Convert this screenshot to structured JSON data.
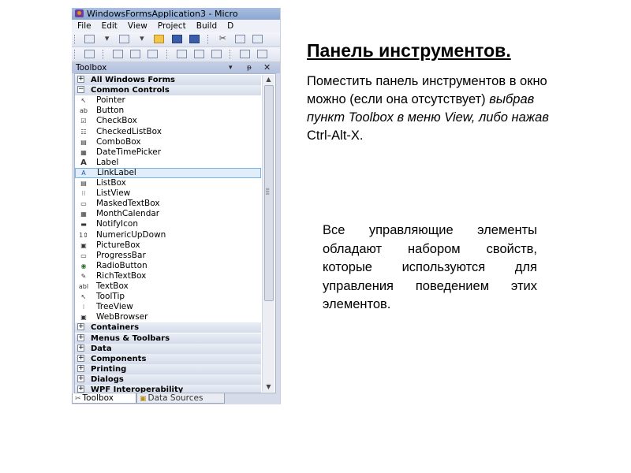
{
  "window": {
    "title": "WindowsFormsApplication3 - Micro",
    "menu": [
      "File",
      "Edit",
      "View",
      "Project",
      "Build",
      "D"
    ]
  },
  "toolbox": {
    "title": "Toolbox",
    "controls": {
      "pin": "▾",
      "autohide": "ᵽ",
      "close": "✕"
    },
    "rows": [
      {
        "kind": "cat",
        "sign": "+",
        "label": "All Windows Forms"
      },
      {
        "kind": "cat",
        "sign": "−",
        "label": "Common Controls"
      },
      {
        "kind": "item",
        "icon": "pointer-icon",
        "glyph": "↖",
        "label": "Pointer"
      },
      {
        "kind": "item",
        "icon": "button-icon",
        "glyph": "ab",
        "label": "Button"
      },
      {
        "kind": "item",
        "icon": "checkbox-icon",
        "glyph": "☑",
        "label": "CheckBox"
      },
      {
        "kind": "item",
        "icon": "checkedlistbox-icon",
        "glyph": "☷",
        "label": "CheckedListBox"
      },
      {
        "kind": "item",
        "icon": "combobox-icon",
        "glyph": "▤",
        "label": "ComboBox"
      },
      {
        "kind": "item",
        "icon": "datetimepicker-icon",
        "glyph": "▦",
        "label": "DateTimePicker"
      },
      {
        "kind": "item",
        "icon": "label-icon",
        "glyph": "A",
        "label": "Label"
      },
      {
        "kind": "item",
        "icon": "linklabel-icon",
        "glyph": "A",
        "label": "LinkLabel",
        "selected": true
      },
      {
        "kind": "item",
        "icon": "listbox-icon",
        "glyph": "▤",
        "label": "ListBox"
      },
      {
        "kind": "item",
        "icon": "listview-icon",
        "glyph": "⁝⁝",
        "label": "ListView"
      },
      {
        "kind": "item",
        "icon": "maskedtextbox-icon",
        "glyph": "▭",
        "label": "MaskedTextBox"
      },
      {
        "kind": "item",
        "icon": "monthcalendar-icon",
        "glyph": "▦",
        "label": "MonthCalendar"
      },
      {
        "kind": "item",
        "icon": "notifyicon-icon",
        "glyph": "▬",
        "label": "NotifyIcon"
      },
      {
        "kind": "item",
        "icon": "numericupdown-icon",
        "glyph": "1⇕",
        "label": "NumericUpDown"
      },
      {
        "kind": "item",
        "icon": "picturebox-icon",
        "glyph": "▣",
        "label": "PictureBox"
      },
      {
        "kind": "item",
        "icon": "progressbar-icon",
        "glyph": "▭",
        "label": "ProgressBar"
      },
      {
        "kind": "item",
        "icon": "radiobutton-icon",
        "glyph": "◉",
        "label": "RadioButton"
      },
      {
        "kind": "item",
        "icon": "richtextbox-icon",
        "glyph": "✎",
        "label": "RichTextBox"
      },
      {
        "kind": "item",
        "icon": "textbox-icon",
        "glyph": "abl",
        "label": "TextBox"
      },
      {
        "kind": "item",
        "icon": "tooltip-icon",
        "glyph": "↖",
        "label": "ToolTip"
      },
      {
        "kind": "item",
        "icon": "treeview-icon",
        "glyph": "⁝",
        "label": "TreeView"
      },
      {
        "kind": "item",
        "icon": "webbrowser-icon",
        "glyph": "▣",
        "label": "WebBrowser"
      },
      {
        "kind": "cat",
        "sign": "+",
        "label": "Containers"
      },
      {
        "kind": "cat",
        "sign": "+",
        "label": "Menus & Toolbars"
      },
      {
        "kind": "cat",
        "sign": "+",
        "label": "Data"
      },
      {
        "kind": "cat",
        "sign": "+",
        "label": "Components"
      },
      {
        "kind": "cat",
        "sign": "+",
        "label": "Printing"
      },
      {
        "kind": "cat",
        "sign": "+",
        "label": "Dialogs"
      },
      {
        "kind": "cat",
        "sign": "+",
        "label": "WPF Interoperability"
      }
    ]
  },
  "bottom_tabs": [
    {
      "label": "Toolbox",
      "glyph": "✂",
      "active": true
    },
    {
      "label": "Data Sources",
      "glyph": "▣",
      "active": false
    }
  ],
  "colors": {
    "selection_fill": "#dfeefa",
    "selection_border": "#7ab3df",
    "toolbox_header": "#b3c1de"
  },
  "slide": {
    "heading": "Панель инструментов.",
    "para1_normal": "Поместить панель инструментов в окно можно (если она отсутствует) ",
    "para1_italic_1": "выбрав пункт Toolbox в меню View, либо нажав",
    "para1_end": " Ctrl-Alt-X.",
    "para2": "Все управляющие элементы обладают набором свойств, которые используются для управления поведением этих элементов."
  }
}
